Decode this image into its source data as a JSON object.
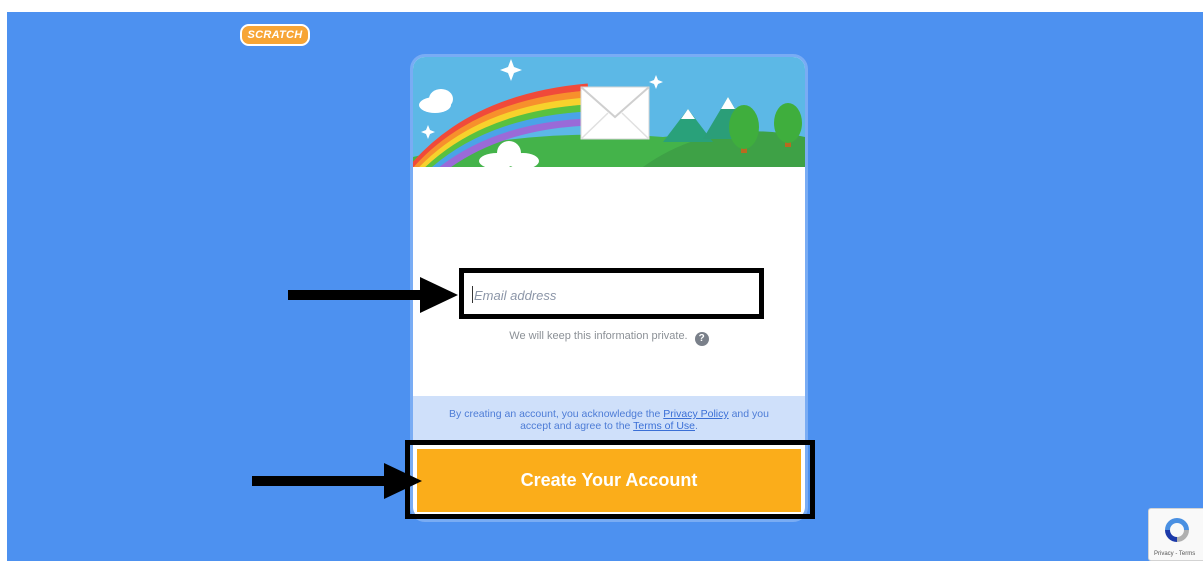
{
  "brand": {
    "logo_text": "SCRATCH"
  },
  "form": {
    "email": {
      "placeholder": "Email address",
      "value": ""
    },
    "privacy_hint": "We will keep this information private.",
    "help_icon": "?"
  },
  "legal": {
    "prefix": "By creating an account, you acknowledge the",
    "privacy_link": "Privacy Policy",
    "middle": "and you accept and agree to the",
    "terms_link": "Terms of Use",
    "suffix": "."
  },
  "cta": {
    "label": "Create Your Account"
  },
  "recaptcha": {
    "label": "Privacy - Terms"
  },
  "colors": {
    "background": "#4d91f0",
    "button": "#fbad1a",
    "legal_bg": "#cfe0fa",
    "annotation": "#000000"
  },
  "icons": [
    "scratch-logo",
    "rainbow-envelope-banner",
    "help-icon",
    "arrow-right-icon",
    "recaptcha-icon"
  ]
}
